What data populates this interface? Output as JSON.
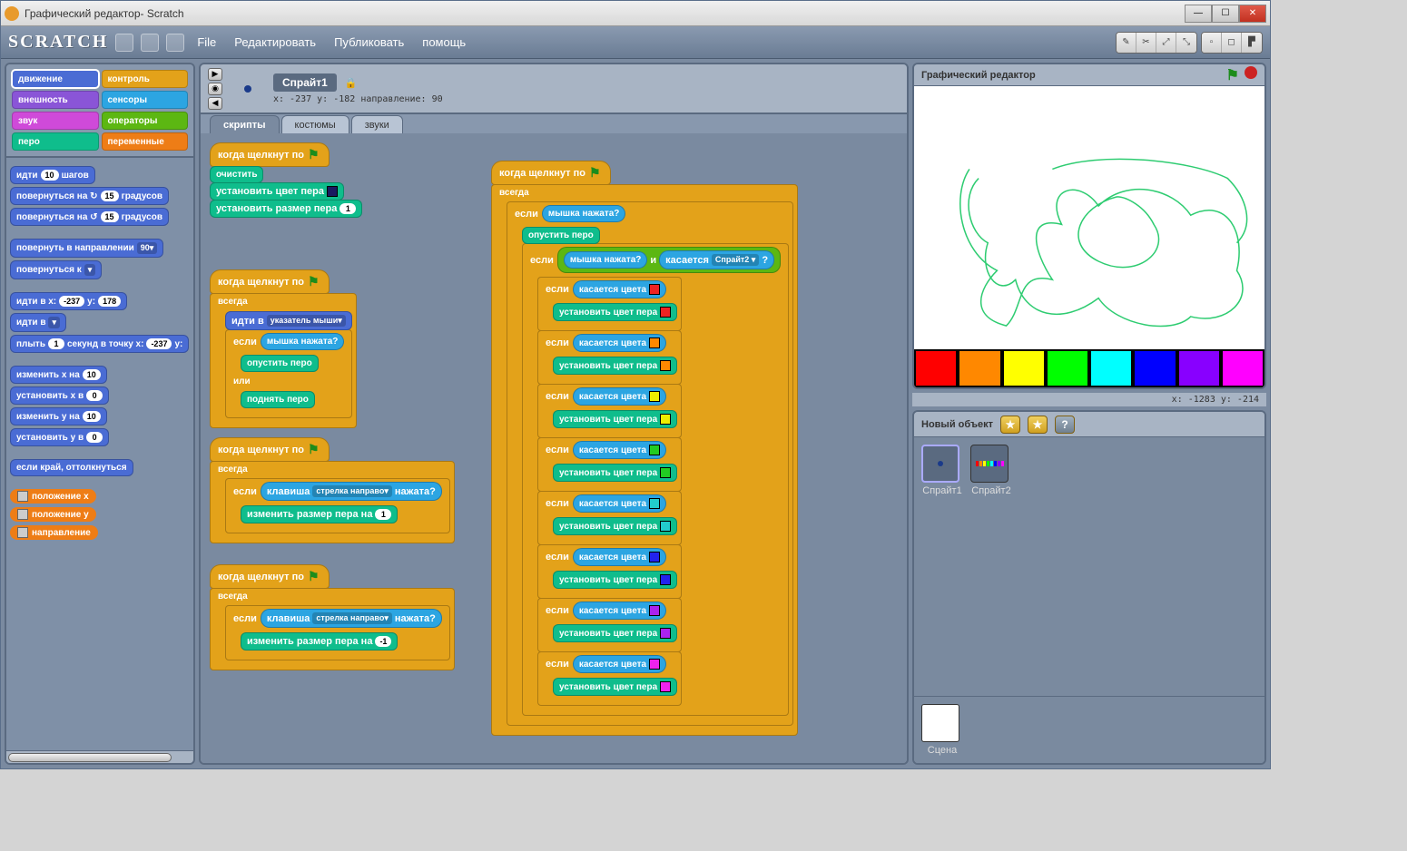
{
  "window": {
    "title": "Графический редактор- Scratch"
  },
  "toolbar": {
    "logo": "SCRATCH",
    "menus": [
      "File",
      "Редактировать",
      "Публиковать",
      "помощь"
    ]
  },
  "categories": [
    {
      "label": "движение",
      "color": "#4a6cd4",
      "selected": true
    },
    {
      "label": "контроль",
      "color": "#e3a21a"
    },
    {
      "label": "внешность",
      "color": "#8a55d7"
    },
    {
      "label": "сенсоры",
      "color": "#2ca5e2"
    },
    {
      "label": "звук",
      "color": "#cf4ad9"
    },
    {
      "label": "операторы",
      "color": "#5cb712"
    },
    {
      "label": "перо",
      "color": "#0fbd8c"
    },
    {
      "label": "переменные",
      "color": "#ee7d16"
    }
  ],
  "palette_blocks": [
    {
      "text": "идти",
      "inputs": [
        "10"
      ],
      "suffix": "шагов"
    },
    {
      "text": "повернуться на ↻",
      "inputs": [
        "15"
      ],
      "suffix": "градусов"
    },
    {
      "text": "повернуться на ↺",
      "inputs": [
        "15"
      ],
      "suffix": "градусов"
    },
    {
      "spacer": true
    },
    {
      "text": "повернуть в направлении",
      "dropdown": "90▾"
    },
    {
      "text": "повернуться к",
      "dropdown": " ▾"
    },
    {
      "spacer": true
    },
    {
      "text": "идти в x:",
      "inputs": [
        "-237"
      ],
      "mid": "y:",
      "inputs2": [
        "178"
      ]
    },
    {
      "text": "идти в",
      "dropdown": " ▾"
    },
    {
      "text": "плыть",
      "inputs": [
        "1"
      ],
      "mid": "секунд в точку x:",
      "inputs2": [
        "-237"
      ],
      "suffix": "y:"
    },
    {
      "spacer": true
    },
    {
      "text": "изменить x на",
      "inputs": [
        "10"
      ]
    },
    {
      "text": "установить x в",
      "inputs": [
        "0"
      ]
    },
    {
      "text": "изменить y на",
      "inputs": [
        "10"
      ]
    },
    {
      "text": "установить y в",
      "inputs": [
        "0"
      ]
    },
    {
      "spacer": true
    },
    {
      "text": "если край, оттолкнуться"
    },
    {
      "spacer": true
    },
    {
      "var": "положение x"
    },
    {
      "var": "положение y"
    },
    {
      "var": "направление"
    }
  ],
  "sprite_header": {
    "name": "Спрайт1",
    "coords": "x: -237 y: -182 направление: 90"
  },
  "tabs": [
    {
      "label": "скрипты",
      "active": true
    },
    {
      "label": "костюмы"
    },
    {
      "label": "звуки"
    }
  ],
  "scripts": {
    "s1_hat": "когда щелкнут по",
    "s1_b1": "очистить",
    "s1_b2": "установить цвет пера",
    "s1_b3_pre": "установить размер пера",
    "s1_b3_val": "1",
    "s2_hat": "когда щелкнут по",
    "s2_forever": "всегда",
    "s2_goto_pre": "идти в",
    "s2_goto_val": "указатель мыши▾",
    "s2_if": "если",
    "s2_cond": "мышка нажата?",
    "s2_pendown": "опустить перо",
    "s2_else": "или",
    "s2_penup": "поднять перо",
    "s3_hat": "когда щелкнут по",
    "s3_forever": "всегда",
    "s3_if": "если",
    "s3_key_pre": "клавиша",
    "s3_key_val": "стрелка направо▾",
    "s3_key_suf": "нажата?",
    "s3_change_pre": "изменить размер пера на",
    "s3_change_val": "1",
    "s4_hat": "когда щелкнут по",
    "s4_forever": "всегда",
    "s4_if": "если",
    "s4_change_val": "-1",
    "r_hat": "когда щелкнут по",
    "r_forever": "всегда",
    "r_if": "если",
    "r_cond": "мышка нажата?",
    "r_pendown": "опустить перо",
    "r_if2": "если",
    "r_and": "и",
    "r_touch_pre": "касается",
    "r_touch_val": "Спрайт2 ▾",
    "r_q": "?",
    "r_touchcolor": "касается цвета",
    "r_setpen": "установить цвет пера",
    "color_swatches": [
      "#e22",
      "#f80",
      "#ee0",
      "#2c2",
      "#2cc",
      "#22e",
      "#a2e",
      "#e2e"
    ]
  },
  "stage": {
    "title": "Графический редактор",
    "coords": "x: -1283 y: -214",
    "palette": [
      "#ff0000",
      "#ff8800",
      "#ffff00",
      "#00ff00",
      "#00ffff",
      "#0000ff",
      "#8800ff",
      "#ff00ff"
    ]
  },
  "sprite_area": {
    "label": "Новый объект",
    "sprites": [
      {
        "name": "Спрайт1",
        "selected": true
      },
      {
        "name": "Спрайт2"
      }
    ],
    "stage_label": "Сцена"
  }
}
